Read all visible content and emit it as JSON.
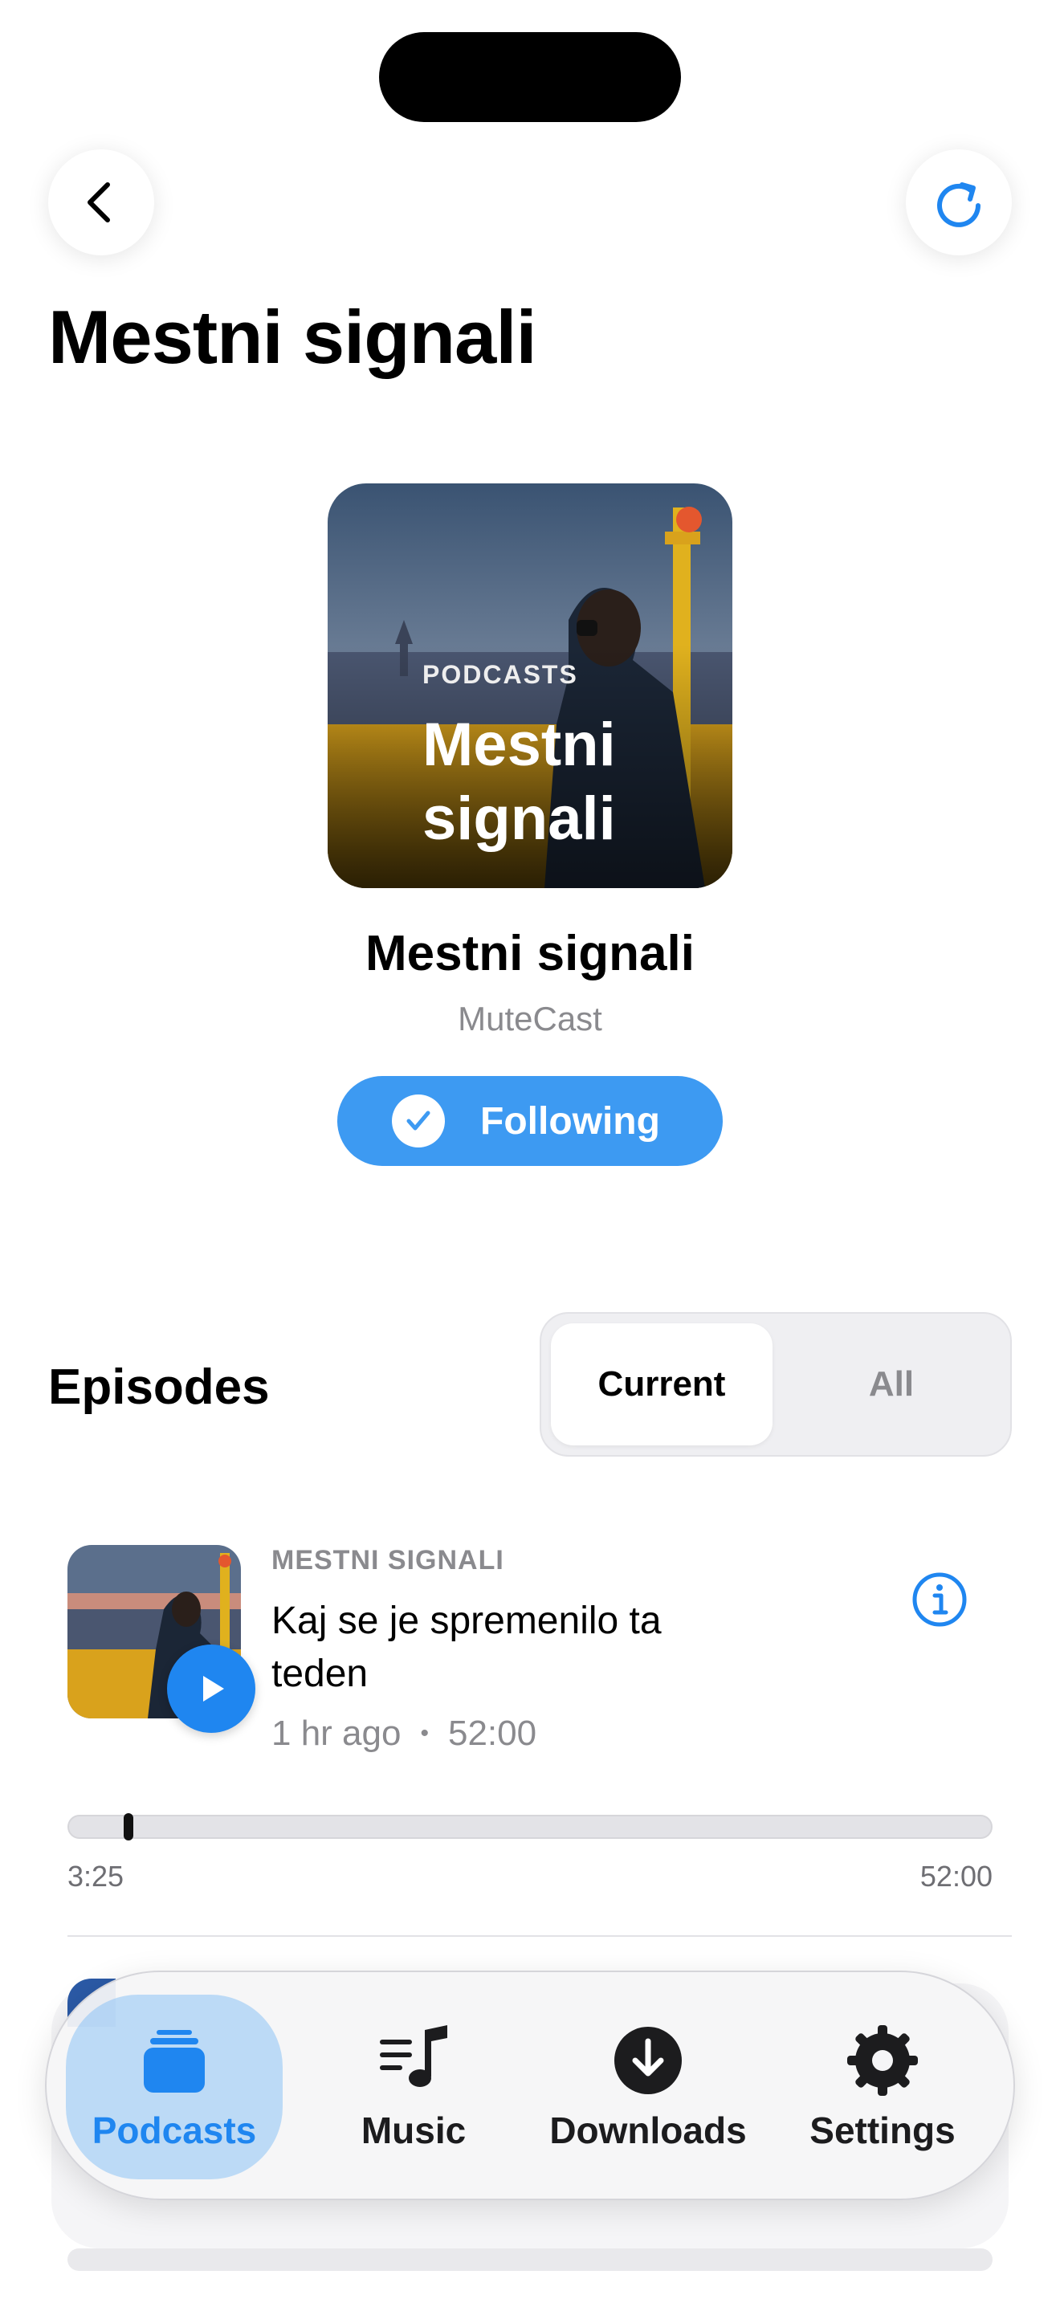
{
  "header": {
    "title": "Mestni signali"
  },
  "podcast": {
    "artwork_kicker": "PODCASTS",
    "artwork_title": "Mestni signali",
    "name": "Mestni signali",
    "publisher": "MuteCast",
    "follow_label": "Following"
  },
  "episodes": {
    "title": "Episodes",
    "segments": [
      "Current",
      "All"
    ],
    "selected_segment": "Current",
    "items": [
      {
        "show": "MESTNI SIGNALI",
        "title": "Kaj se je spremenilo ta teden",
        "age": "1 hr ago",
        "separator": "•",
        "duration": "52:00",
        "elapsed": "3:25",
        "progress_fraction": 0.066
      }
    ]
  },
  "tabbar": {
    "tabs": [
      {
        "label": "Podcasts",
        "icon": "podcasts-stack-icon",
        "active": true
      },
      {
        "label": "Music",
        "icon": "music-list-icon",
        "active": false
      },
      {
        "label": "Downloads",
        "icon": "download-icon",
        "active": false
      },
      {
        "label": "Settings",
        "icon": "gear-icon",
        "active": false
      }
    ]
  },
  "colors": {
    "accent": "#1f86f0",
    "follow_button": "#3d9af2",
    "secondary_text": "#8a8a8e"
  }
}
